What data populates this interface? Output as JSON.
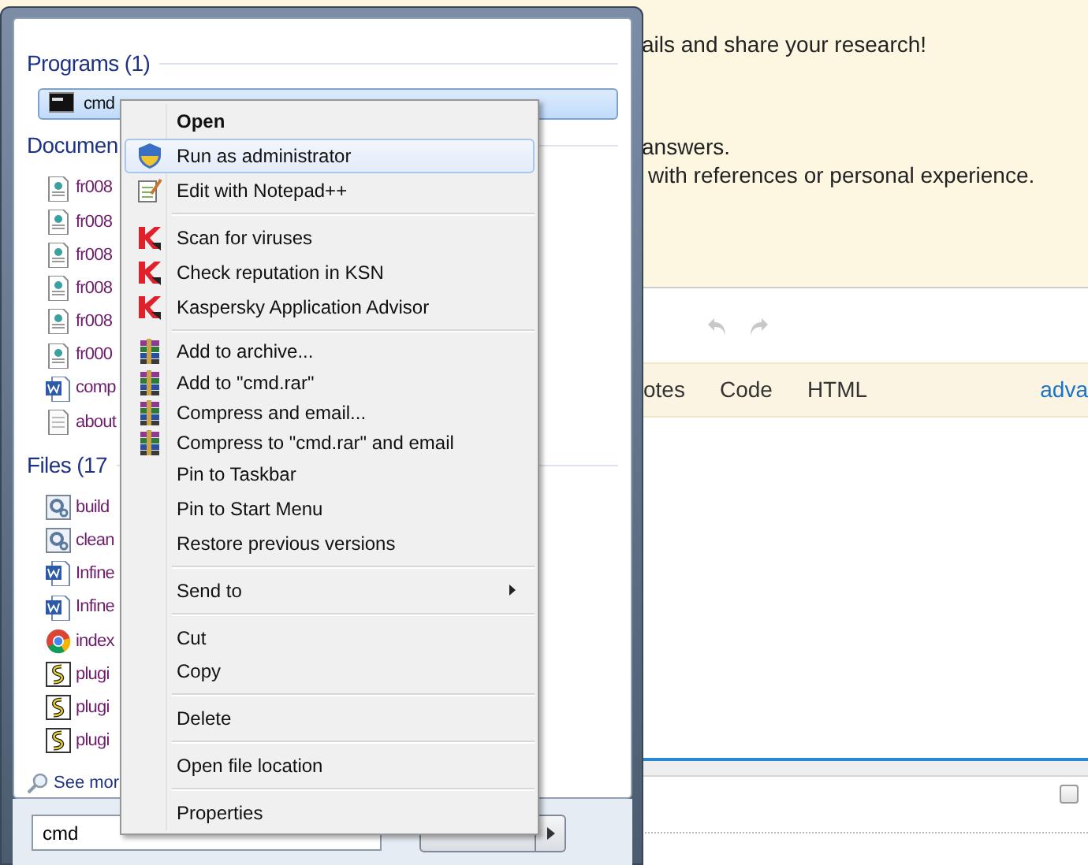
{
  "web_page": {
    "notice_lines": [
      "ails and share your research!",
      "answers.",
      "with references or personal experience."
    ],
    "editor_tabs": [
      {
        "label": "otes",
        "kind": "tab"
      },
      {
        "label": "Code",
        "kind": "tab"
      },
      {
        "label": "HTML",
        "kind": "tab"
      },
      {
        "label": "adva",
        "kind": "link"
      }
    ],
    "checkbox": {
      "checked": false
    }
  },
  "start_menu": {
    "sections": [
      {
        "header": "Programs (1)",
        "items": [
          {
            "label": "cmd",
            "kind": "console",
            "selected": true
          }
        ]
      },
      {
        "header": "Documen",
        "items": [
          {
            "label": "fr008",
            "kind": "webpage",
            "selected": false
          },
          {
            "label": "fr008",
            "kind": "webpage",
            "selected": false
          },
          {
            "label": "fr008",
            "kind": "webpage",
            "selected": false
          },
          {
            "label": "fr008",
            "kind": "webpage",
            "selected": false
          },
          {
            "label": "fr008",
            "kind": "webpage",
            "selected": false
          },
          {
            "label": "fr000",
            "kind": "webpage",
            "selected": false
          },
          {
            "label": "comp",
            "kind": "word",
            "selected": false
          },
          {
            "label": "about",
            "kind": "text",
            "selected": false
          }
        ]
      },
      {
        "header": "Files (17",
        "items": [
          {
            "label": "build",
            "kind": "batch",
            "selected": false
          },
          {
            "label": "clean",
            "kind": "batch",
            "selected": false
          },
          {
            "label": "Infine",
            "kind": "word",
            "selected": false
          },
          {
            "label": "Infine",
            "kind": "word",
            "selected": false
          },
          {
            "label": "index",
            "kind": "chrome",
            "selected": false
          },
          {
            "label": "plugi",
            "kind": "script",
            "selected": false
          },
          {
            "label": "plugi",
            "kind": "script",
            "selected": false
          },
          {
            "label": "plugi",
            "kind": "script",
            "selected": false
          }
        ]
      }
    ],
    "see_more": "See mor",
    "search": {
      "value": "cmd"
    }
  },
  "context_menu": {
    "groups": [
      [
        {
          "label": "Open",
          "kind": "plain",
          "default": true,
          "selected": false
        },
        {
          "label": "Run as administrator",
          "kind": "shield",
          "default": false,
          "selected": true
        },
        {
          "label": "Edit with Notepad++",
          "kind": "notepad",
          "default": false,
          "selected": false
        }
      ],
      [
        {
          "label": "Scan for viruses",
          "kind": "kaspersky",
          "default": false,
          "selected": false
        },
        {
          "label": "Check reputation in KSN",
          "kind": "kaspersky",
          "default": false,
          "selected": false
        },
        {
          "label": "Kaspersky Application Advisor",
          "kind": "kaspersky",
          "default": false,
          "selected": false
        }
      ],
      [
        {
          "label": "Add to archive...",
          "kind": "archive",
          "default": false,
          "selected": false
        },
        {
          "label": "Add to \"cmd.rar\"",
          "kind": "archive",
          "default": false,
          "selected": false
        },
        {
          "label": "Compress and email...",
          "kind": "archive",
          "default": false,
          "selected": false
        },
        {
          "label": "Compress to \"cmd.rar\" and email",
          "kind": "archive",
          "default": false,
          "selected": false
        },
        {
          "label": "Pin to Taskbar",
          "kind": "plain",
          "default": false,
          "selected": false
        },
        {
          "label": "Pin to Start Menu",
          "kind": "plain",
          "default": false,
          "selected": false
        },
        {
          "label": "Restore previous versions",
          "kind": "plain",
          "default": false,
          "selected": false
        }
      ],
      [
        {
          "label": "Send to",
          "kind": "plain",
          "default": false,
          "selected": false,
          "submenu": true
        }
      ],
      [
        {
          "label": "Cut",
          "kind": "plain",
          "default": false,
          "selected": false
        },
        {
          "label": "Copy",
          "kind": "plain",
          "default": false,
          "selected": false
        }
      ],
      [
        {
          "label": "Delete",
          "kind": "plain",
          "default": false,
          "selected": false
        }
      ],
      [
        {
          "label": "Open file location",
          "kind": "plain",
          "default": false,
          "selected": false
        }
      ],
      [
        {
          "label": "Properties",
          "kind": "plain",
          "default": false,
          "selected": false
        }
      ]
    ]
  }
}
